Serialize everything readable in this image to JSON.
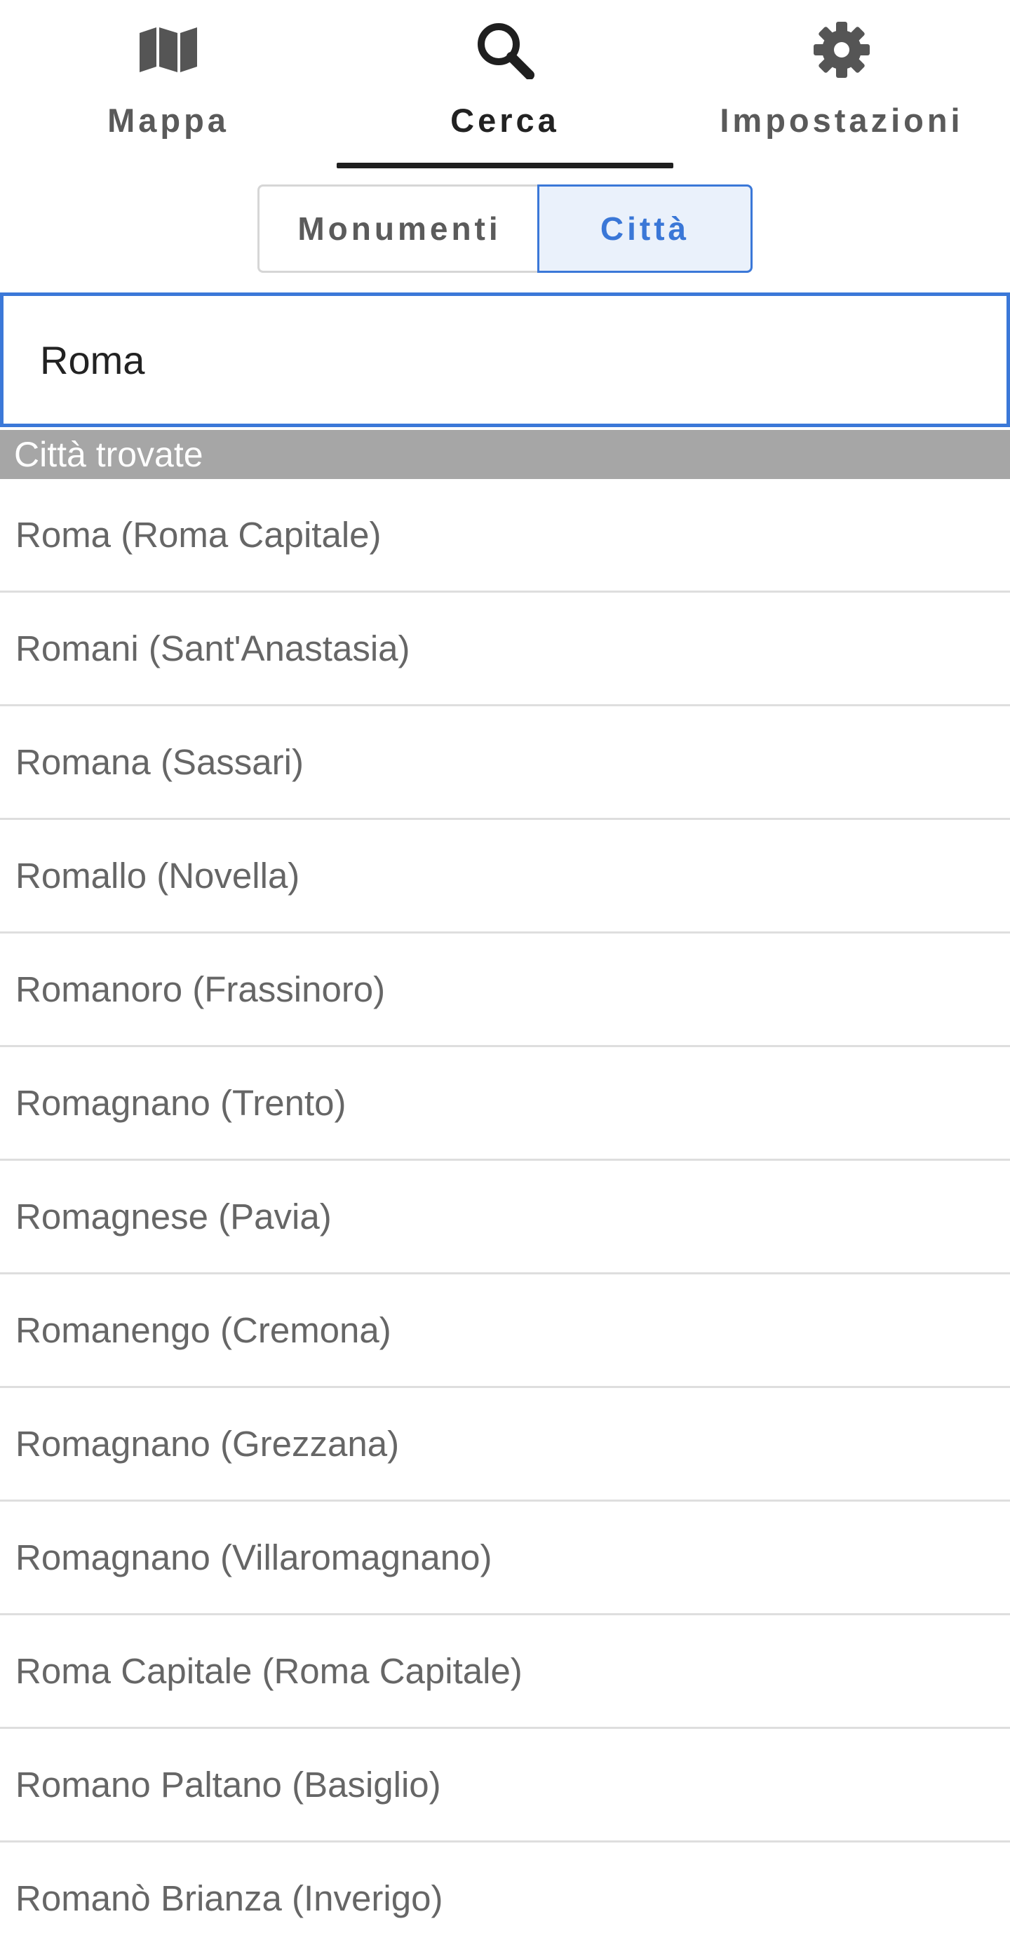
{
  "tabs": [
    {
      "label": "Mappa",
      "icon": "map-icon",
      "active": false
    },
    {
      "label": "Cerca",
      "icon": "search-icon",
      "active": true
    },
    {
      "label": "Impostazioni",
      "icon": "gear-icon",
      "active": false
    }
  ],
  "segmented": {
    "monumenti_label": "Monumenti",
    "citta_label": "Città",
    "selected": "Città"
  },
  "search": {
    "value": "Roma"
  },
  "results": {
    "header": "Città trovate",
    "items": [
      "Roma (Roma Capitale)",
      "Romani (Sant'Anastasia)",
      "Romana (Sassari)",
      "Romallo (Novella)",
      "Romanoro (Frassinoro)",
      "Romagnano (Trento)",
      "Romagnese (Pavia)",
      "Romanengo (Cremona)",
      "Romagnano (Grezzana)",
      "Romagnano (Villaromagnano)",
      "Roma Capitale (Roma Capitale)",
      "Romano Paltano (Basiglio)",
      "Romanò Brianza (Inverigo)"
    ]
  },
  "colors": {
    "accent": "#3b78d8",
    "accent_bg": "#eaf1fb",
    "header_bg": "#a6a6a6",
    "icon_gray": "#555555",
    "icon_dark": "#1f1f1f"
  }
}
